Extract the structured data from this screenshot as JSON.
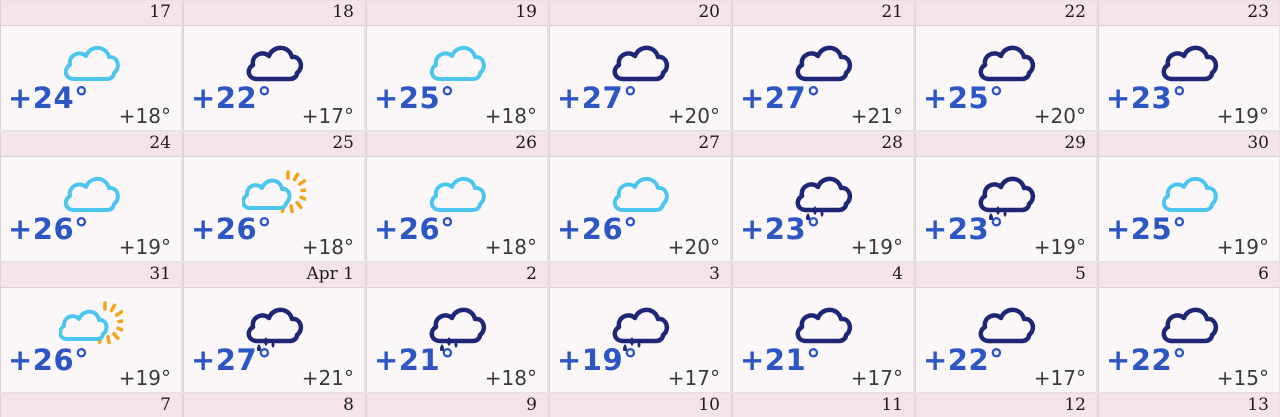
{
  "colors": {
    "light_cloud": "#4cc6ee",
    "dark_cloud": "#1e2676",
    "sun": "#f5a31a",
    "temp_high": "#2c56c4",
    "header_bg": "#f4e4ea"
  },
  "weeks": [
    {
      "days": [
        {
          "date": "17",
          "icon": "cloudy-light-icon",
          "high": "+24°",
          "low": "+18°"
        },
        {
          "date": "18",
          "icon": "cloudy-dark-icon",
          "high": "+22°",
          "low": "+17°"
        },
        {
          "date": "19",
          "icon": "cloudy-light-icon",
          "high": "+25°",
          "low": "+18°"
        },
        {
          "date": "20",
          "icon": "cloudy-dark-icon",
          "high": "+27°",
          "low": "+20°"
        },
        {
          "date": "21",
          "icon": "cloudy-dark-icon",
          "high": "+27°",
          "low": "+21°"
        },
        {
          "date": "22",
          "icon": "cloudy-dark-icon",
          "high": "+25°",
          "low": "+20°"
        },
        {
          "date": "23",
          "icon": "cloudy-dark-icon",
          "high": "+23°",
          "low": "+19°"
        }
      ]
    },
    {
      "days": [
        {
          "date": "24",
          "icon": "cloudy-light-icon",
          "high": "+26°",
          "low": "+19°"
        },
        {
          "date": "25",
          "icon": "partly-sunny-icon",
          "high": "+26°",
          "low": "+18°"
        },
        {
          "date": "26",
          "icon": "cloudy-light-icon",
          "high": "+26°",
          "low": "+18°"
        },
        {
          "date": "27",
          "icon": "cloudy-light-icon",
          "high": "+26°",
          "low": "+20°"
        },
        {
          "date": "28",
          "icon": "rain-cloud-icon",
          "high": "+23°",
          "low": "+19°"
        },
        {
          "date": "29",
          "icon": "rain-cloud-icon",
          "high": "+23°",
          "low": "+19°"
        },
        {
          "date": "30",
          "icon": "cloudy-light-icon",
          "high": "+25°",
          "low": "+19°"
        }
      ]
    },
    {
      "days": [
        {
          "date": "31",
          "icon": "partly-sunny-icon",
          "high": "+26°",
          "low": "+19°"
        },
        {
          "date": "Apr 1",
          "icon": "rain-cloud-icon",
          "high": "+27°",
          "low": "+21°"
        },
        {
          "date": "2",
          "icon": "rain-cloud-icon",
          "high": "+21°",
          "low": "+18°"
        },
        {
          "date": "3",
          "icon": "rain-cloud-icon",
          "high": "+19°",
          "low": "+17°"
        },
        {
          "date": "4",
          "icon": "cloudy-dark-icon",
          "high": "+21°",
          "low": "+17°"
        },
        {
          "date": "5",
          "icon": "cloudy-dark-icon",
          "high": "+22°",
          "low": "+17°"
        },
        {
          "date": "6",
          "icon": "cloudy-dark-icon",
          "high": "+22°",
          "low": "+15°"
        }
      ]
    },
    {
      "days": [
        {
          "date": "7"
        },
        {
          "date": "8"
        },
        {
          "date": "9"
        },
        {
          "date": "10"
        },
        {
          "date": "11"
        },
        {
          "date": "12"
        },
        {
          "date": "13"
        }
      ]
    }
  ]
}
